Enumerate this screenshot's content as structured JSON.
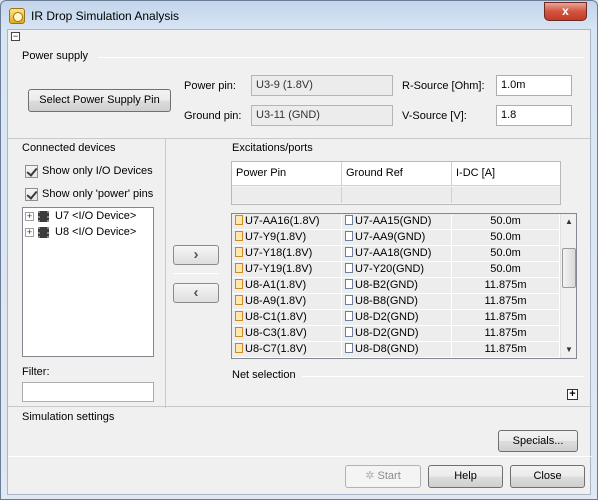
{
  "window": {
    "title": "IR Drop Simulation Analysis",
    "close_glyph": "x"
  },
  "power_supply": {
    "group_label": "Power supply",
    "select_button": "Select Power Supply Pin",
    "power_pin_label": "Power pin:",
    "power_pin_value": "U3-9 (1.8V)",
    "ground_pin_label": "Ground pin:",
    "ground_pin_value": "U3-11 (GND)",
    "r_source_label": "R-Source [Ohm]:",
    "r_source_value": "1.0m",
    "v_source_label": "V-Source [V]:",
    "v_source_value": "1.8"
  },
  "connected_devices": {
    "group_label": "Connected devices",
    "show_io_label": "Show only I/O Devices",
    "show_io_checked": true,
    "show_power_label": "Show only 'power' pins",
    "show_power_checked": true,
    "tree": [
      {
        "label": "U7 <I/O Device>",
        "icon": "chip-icon"
      },
      {
        "label": "U8 <I/O Device>",
        "icon": "chip-icon"
      }
    ],
    "filter_label": "Filter:",
    "filter_value": ""
  },
  "transfer": {
    "add_glyph": "›",
    "remove_glyph": "‹"
  },
  "excitations": {
    "group_label": "Excitations/ports",
    "columns": [
      "Power Pin",
      "Ground Ref",
      "I-DC [A]"
    ],
    "rows": [
      {
        "power_pin": "U7-AA16(1.8V)",
        "ground_ref": "U7-AA15(GND)",
        "idc": "50.0m"
      },
      {
        "power_pin": "U7-Y9(1.8V)",
        "ground_ref": "U7-AA9(GND)",
        "idc": "50.0m"
      },
      {
        "power_pin": "U7-Y18(1.8V)",
        "ground_ref": "U7-AA18(GND)",
        "idc": "50.0m"
      },
      {
        "power_pin": "U7-Y19(1.8V)",
        "ground_ref": "U7-Y20(GND)",
        "idc": "50.0m"
      },
      {
        "power_pin": "U8-A1(1.8V)",
        "ground_ref": "U8-B2(GND)",
        "idc": "11.875m"
      },
      {
        "power_pin": "U8-A9(1.8V)",
        "ground_ref": "U8-B8(GND)",
        "idc": "11.875m"
      },
      {
        "power_pin": "U8-C1(1.8V)",
        "ground_ref": "U8-D2(GND)",
        "idc": "11.875m"
      },
      {
        "power_pin": "U8-C3(1.8V)",
        "ground_ref": "U8-D2(GND)",
        "idc": "11.875m"
      },
      {
        "power_pin": "U8-C7(1.8V)",
        "ground_ref": "U8-D8(GND)",
        "idc": "11.875m"
      }
    ]
  },
  "net_selection": {
    "group_label": "Net selection"
  },
  "simulation_settings": {
    "group_label": "Simulation settings",
    "specials_button": "Specials..."
  },
  "footer": {
    "start_button": "Start",
    "help_button": "Help",
    "close_button": "Close"
  }
}
